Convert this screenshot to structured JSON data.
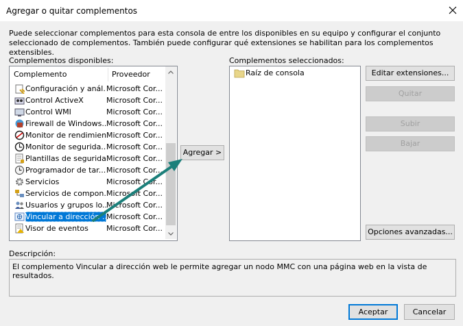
{
  "window": {
    "title": "Agregar o quitar complementos"
  },
  "intro": "Puede seleccionar complementos para esta consola de entre los disponibles en su equipo y configurar el conjunto seleccionado de complementos. También puede configurar qué extensiones se habilitan para los complementos extensibles.",
  "available": {
    "label": "Complementos disponibles:",
    "col_name": "Complemento",
    "col_provider": "Proveedor",
    "items": [
      {
        "name": "Configuración y anál...",
        "provider": "Microsoft Cor...",
        "icon": "config-analysis-icon"
      },
      {
        "name": "Control ActiveX",
        "provider": "Microsoft Cor...",
        "icon": "activex-icon"
      },
      {
        "name": "Control WMI",
        "provider": "Microsoft Cor...",
        "icon": "wmi-icon"
      },
      {
        "name": "Firewall de Windows...",
        "provider": "Microsoft Cor...",
        "icon": "firewall-icon"
      },
      {
        "name": "Monitor de rendimiento",
        "provider": "Microsoft Cor...",
        "icon": "performance-monitor-icon"
      },
      {
        "name": "Monitor de segurida...",
        "provider": "Microsoft Cor...",
        "icon": "security-monitor-icon"
      },
      {
        "name": "Plantillas de seguridad",
        "provider": "Microsoft Cor...",
        "icon": "security-templates-icon"
      },
      {
        "name": "Programador de tar...",
        "provider": "Microsoft Cor...",
        "icon": "task-scheduler-icon"
      },
      {
        "name": "Servicios",
        "provider": "Microsoft Cor...",
        "icon": "services-icon"
      },
      {
        "name": "Servicios de compon...",
        "provider": "Microsoft Cor...",
        "icon": "component-services-icon"
      },
      {
        "name": "Usuarios y grupos lo...",
        "provider": "Microsoft Cor...",
        "icon": "users-groups-icon"
      },
      {
        "name": "Vincular a dirección ...",
        "provider": "Microsoft Cor...",
        "icon": "web-link-icon",
        "selected": true
      },
      {
        "name": "Visor de eventos",
        "provider": "Microsoft Cor...",
        "icon": "event-viewer-icon"
      }
    ]
  },
  "add_button": "Agregar >",
  "selected": {
    "label": "Complementos seleccionados:",
    "items": [
      {
        "name": "Raíz de consola",
        "icon": "folder-icon"
      }
    ]
  },
  "buttons": {
    "edit_extensions": "Editar extensiones...",
    "remove": "Quitar",
    "move_up": "Subir",
    "move_down": "Bajar",
    "advanced": "Opciones avanzadas...",
    "ok": "Aceptar",
    "cancel": "Cancelar"
  },
  "description": {
    "label": "Descripción:",
    "text": "El complemento Vincular a dirección web le permite agregar un nodo MMC con una página web en la vista de resultados."
  },
  "colors": {
    "selection": "#0078d7",
    "arrow": "#1b7f7a"
  }
}
